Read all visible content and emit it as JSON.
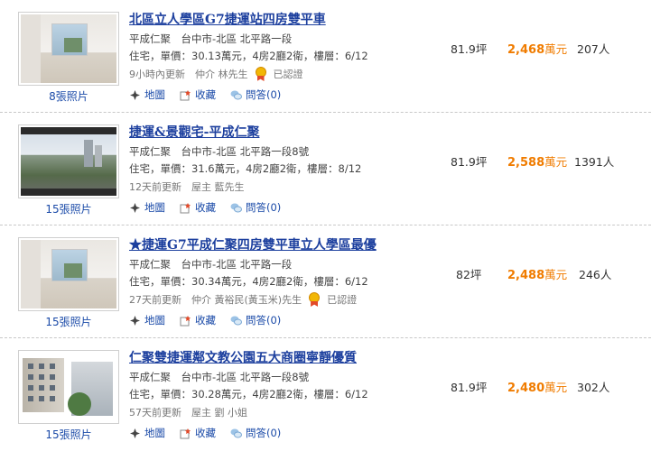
{
  "listings": [
    {
      "photo_count": "8張照片",
      "title": "北區立人學區G7捷運站四房雙平車",
      "info_line1": "平成仁聚　台中市-北區 北平路一段",
      "info_line2": "住宅，單價：30.13萬元，4房2廳2衛，樓層：6/12",
      "update": "9小時內更新　仲介 林先生",
      "certified": "已認證",
      "area": "81.9坪",
      "price_number": "2,468",
      "price_unit": "萬元",
      "views": "207人",
      "actions": {
        "map": "地圖",
        "save": "收藏",
        "qa": "問答(0)"
      }
    },
    {
      "photo_count": "15張照片",
      "title": "捷運&景觀宅-平成仁聚",
      "info_line1": "平成仁聚　台中市-北區 北平路一段8號",
      "info_line2": "住宅，單價：31.6萬元，4房2廳2衛，樓層：8/12",
      "update": "12天前更新　屋主 藍先生",
      "certified": "",
      "area": "81.9坪",
      "price_number": "2,588",
      "price_unit": "萬元",
      "views": "1391人",
      "actions": {
        "map": "地圖",
        "save": "收藏",
        "qa": "問答(0)"
      }
    },
    {
      "photo_count": "15張照片",
      "title": "★捷運G7平成仁聚四房雙平車立人學區最優",
      "info_line1": "平成仁聚　台中市-北區 北平路一段",
      "info_line2": "住宅，單價：30.34萬元，4房2廳2衛，樓層：6/12",
      "update": "27天前更新　仲介 黃裕民(黃玉米)先生",
      "certified": "已認證",
      "area": "82坪",
      "price_number": "2,488",
      "price_unit": "萬元",
      "views": "246人",
      "actions": {
        "map": "地圖",
        "save": "收藏",
        "qa": "問答(0)"
      }
    },
    {
      "photo_count": "15張照片",
      "title": "仁聚雙捷運鄰文教公園五大商圈寧靜優質",
      "info_line1": "平成仁聚　台中市-北區 北平路一段8號",
      "info_line2": "住宅，單價：30.28萬元，4房2廳2衛，樓層：6/12",
      "update": "57天前更新　屋主 劉 小姐",
      "certified": "",
      "area": "81.9坪",
      "price_number": "2,480",
      "price_unit": "萬元",
      "views": "302人",
      "actions": {
        "map": "地圖",
        "save": "收藏",
        "qa": "問答(0)"
      }
    }
  ],
  "colors": {
    "title": "#1c3f9e",
    "price": "#f07c00",
    "link": "#1a4aa8"
  },
  "icons": [
    "map-icon",
    "favorite-icon",
    "qa-icon",
    "certified-medal-icon"
  ]
}
